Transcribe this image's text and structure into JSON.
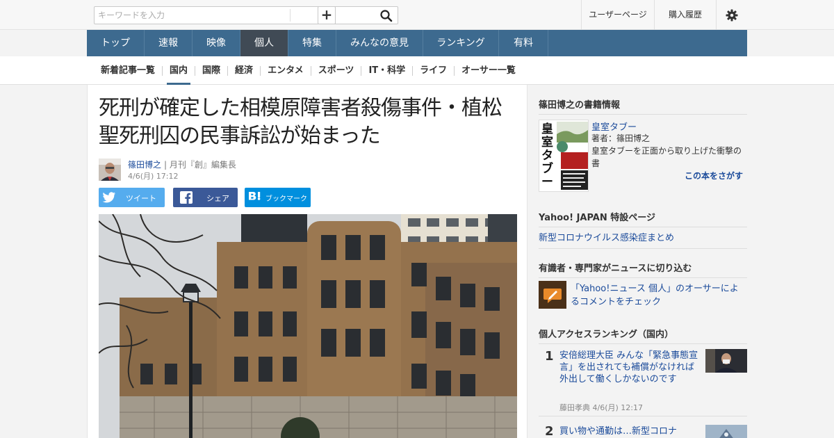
{
  "search": {
    "placeholder": "キーワードを入力"
  },
  "topbar": {
    "user_page": "ユーザーページ",
    "purchase_history": "購入履歴"
  },
  "gnav": {
    "items": [
      {
        "label": "トップ",
        "active": false
      },
      {
        "label": "速報",
        "active": false
      },
      {
        "label": "映像",
        "active": false
      },
      {
        "label": "個人",
        "active": true
      },
      {
        "label": "特集",
        "active": false
      },
      {
        "label": "みんなの意見",
        "active": false
      },
      {
        "label": "ランキング",
        "active": false
      },
      {
        "label": "有料",
        "active": false
      }
    ]
  },
  "subnav": {
    "items": [
      {
        "label": "新着記事一覧",
        "active": false
      },
      {
        "label": "国内",
        "active": true
      },
      {
        "label": "国際",
        "active": false
      },
      {
        "label": "経済",
        "active": false
      },
      {
        "label": "エンタメ",
        "active": false
      },
      {
        "label": "スポーツ",
        "active": false
      },
      {
        "label": "IT・科学",
        "active": false
      },
      {
        "label": "ライフ",
        "active": false
      },
      {
        "label": "オーサー一覧",
        "active": false
      }
    ]
  },
  "article": {
    "title": "死刑が確定した相模原障害者殺傷事件・植松聖死刑囚の民事訴訟が始まった",
    "author_name": "篠田博之",
    "author_title": "| 月刊『創』編集長",
    "date": "4/6(月) 17:12"
  },
  "share": {
    "tweet": "ツイート",
    "share": "シェア",
    "bookmark": "ブックマーク"
  },
  "sidebar": {
    "book_section": {
      "heading": "篠田博之の書籍情報",
      "cover_text": "皇室タブー",
      "title": "皇室タブー",
      "author": "著者：篠田博之",
      "description": "皇室タブーを正面から取り上げた衝撃の書",
      "link": "この本をさがす"
    },
    "special_section": {
      "heading": "Yahoo! JAPAN 特設ページ",
      "link": "新型コロナウイルス感染症まとめ"
    },
    "expert_section": {
      "heading": "有識者・専門家がニュースに切り込む",
      "link": "「Yahoo!ニュース 個人」のオーサーによるコメントをチェック"
    },
    "ranking_section": {
      "heading": "個人アクセスランキング（国内）",
      "items": [
        {
          "rank": "1",
          "title": "安倍総理大臣 みんな「緊急事態宣言」を出されても補償がなければ外出して働くしかないのです",
          "meta": "藤田孝典 4/6(月) 12:17"
        },
        {
          "rank": "2",
          "title": "買い物や通勤は…新型コロナ",
          "meta": ""
        }
      ]
    }
  },
  "colors": {
    "nav_bg": "#3d6a8f",
    "nav_active": "#404a55",
    "link": "#1a4a9a",
    "twitter": "#55acee",
    "facebook": "#3b5998",
    "hatena": "#008fde"
  }
}
